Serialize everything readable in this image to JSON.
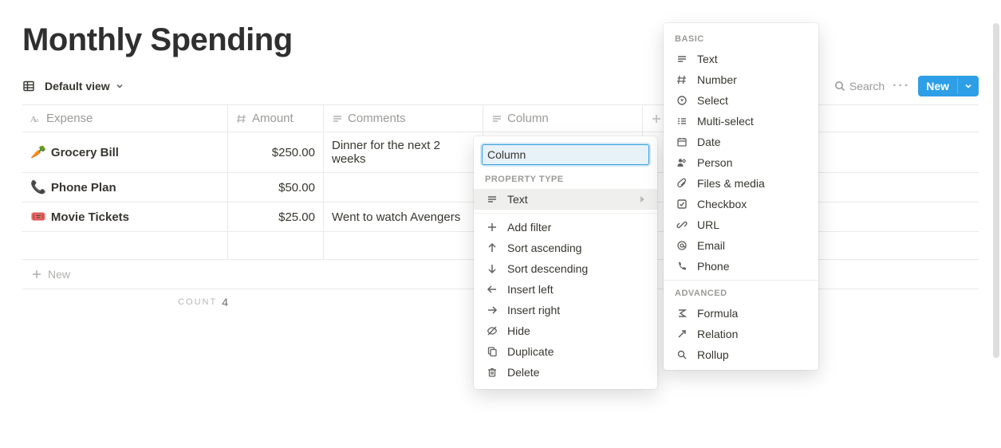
{
  "title": "Monthly Spending",
  "view": {
    "label": "Default view"
  },
  "toolbar": {
    "search_label": "Search",
    "new_label": "New"
  },
  "columns": {
    "expense": "Expense",
    "amount": "Amount",
    "comments": "Comments",
    "column": "Column"
  },
  "rows": [
    {
      "emoji": "🥕",
      "expense": "Grocery Bill",
      "amount": "$250.00",
      "comments": "Dinner for the next 2 weeks"
    },
    {
      "emoji": "📞",
      "expense": "Phone Plan",
      "amount": "$50.00",
      "comments": ""
    },
    {
      "emoji": "🎟️",
      "expense": "Movie Tickets",
      "amount": "$25.00",
      "comments": "Went to watch Avengers"
    }
  ],
  "newrow_label": "New",
  "footer": {
    "count_label": "COUNT",
    "count_value": "4"
  },
  "column_menu": {
    "name_value": "Column",
    "section_property_type": "PROPERTY TYPE",
    "current_type": "Text",
    "actions": {
      "add_filter": "Add filter",
      "sort_asc": "Sort ascending",
      "sort_desc": "Sort descending",
      "insert_left": "Insert left",
      "insert_right": "Insert right",
      "hide": "Hide",
      "duplicate": "Duplicate",
      "delete": "Delete"
    }
  },
  "type_menu": {
    "section_basic": "BASIC",
    "section_advanced": "ADVANCED",
    "basic": {
      "text": "Text",
      "number": "Number",
      "select": "Select",
      "multiselect": "Multi-select",
      "date": "Date",
      "person": "Person",
      "files": "Files & media",
      "checkbox": "Checkbox",
      "url": "URL",
      "email": "Email",
      "phone": "Phone"
    },
    "advanced": {
      "formula": "Formula",
      "relation": "Relation",
      "rollup": "Rollup"
    }
  }
}
